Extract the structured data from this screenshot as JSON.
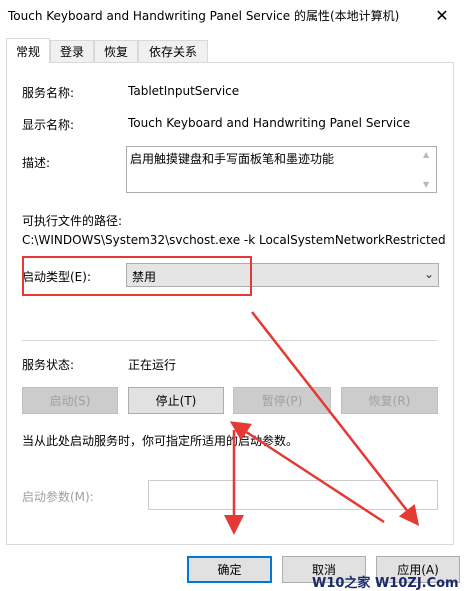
{
  "window": {
    "title": "Touch Keyboard and Handwriting Panel Service 的属性(本地计算机)",
    "close_glyph": "✕"
  },
  "tabs": [
    {
      "label": "常规",
      "active": true
    },
    {
      "label": "登录",
      "active": false
    },
    {
      "label": "恢复",
      "active": false
    },
    {
      "label": "依存关系",
      "active": false
    }
  ],
  "general": {
    "service_name_label": "服务名称:",
    "service_name": "TabletInputService",
    "display_name_label": "显示名称:",
    "display_name": "Touch Keyboard and Handwriting Panel Service",
    "description_label": "描述:",
    "description": "启用触摸键盘和手写面板笔和墨迹功能",
    "path_label": "可执行文件的路径:",
    "path": "C:\\WINDOWS\\System32\\svchost.exe -k LocalSystemNetworkRestricted",
    "startup_type_label": "启动类型(E):",
    "startup_type": "禁用",
    "status_label": "服务状态:",
    "status": "正在运行",
    "hint": "当从此处启动服务时，你可指定所适用的启动参数。",
    "param_label": "启动参数(M):",
    "param_value": ""
  },
  "service_buttons": {
    "start": "启动(S)",
    "stop": "停止(T)",
    "pause": "暂停(P)",
    "resume": "恢复(R)"
  },
  "dialog_buttons": {
    "ok": "确定",
    "cancel": "取消",
    "apply": "应用(A)"
  },
  "watermark": "W10之家 W10ZJ.Com",
  "colors": {
    "annotation_red": "#e53935",
    "focus_blue": "#0078d7"
  }
}
